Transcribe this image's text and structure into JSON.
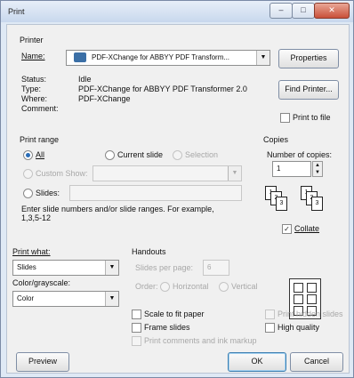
{
  "window": {
    "title": "Print",
    "minimize": "–",
    "maximize": "□",
    "close": "✕"
  },
  "printer": {
    "group_label": "Printer",
    "name_label": "Name:",
    "name_value": "PDF-XChange for ABBYY PDF Transform...",
    "properties_button": "Properties",
    "status_label": "Status:",
    "status_value": "Idle",
    "type_label": "Type:",
    "type_value": "PDF-XChange for ABBYY PDF Transformer 2.0",
    "where_label": "Where:",
    "where_value": "PDF-XChange",
    "comment_label": "Comment:",
    "find_printer_button": "Find Printer...",
    "print_to_file_label": "Print to file"
  },
  "print_range": {
    "label": "Print range",
    "all_label": "All",
    "current_slide_label": "Current slide",
    "selection_label": "Selection",
    "custom_show_label": "Custom Show:",
    "slides_label": "Slides:",
    "hint": "Enter slide numbers and/or slide ranges. For example,",
    "hint_example": "1,3,5-12"
  },
  "copies": {
    "label": "Copies",
    "number_label": "Number of copies:",
    "number_value": "1",
    "collate_label": "Collate",
    "pages": [
      "1",
      "2",
      "3",
      "1",
      "2",
      "3"
    ]
  },
  "print_what": {
    "label": "Print what:",
    "value": "Slides"
  },
  "color": {
    "label": "Color/grayscale:",
    "value": "Color"
  },
  "handouts": {
    "label": "Handouts",
    "slides_per_page_label": "Slides per page:",
    "slides_per_page_value": "6",
    "order_label": "Order:",
    "horizontal_label": "Horizontal",
    "vertical_label": "Vertical"
  },
  "options": {
    "scale_to_fit": "Scale to fit paper",
    "frame_slides": "Frame slides",
    "print_comments": "Print comments and ink markup",
    "print_hidden": "Print hidden slides",
    "high_quality": "High quality"
  },
  "footer": {
    "preview_button": "Preview",
    "ok_button": "OK",
    "cancel_button": "Cancel"
  }
}
